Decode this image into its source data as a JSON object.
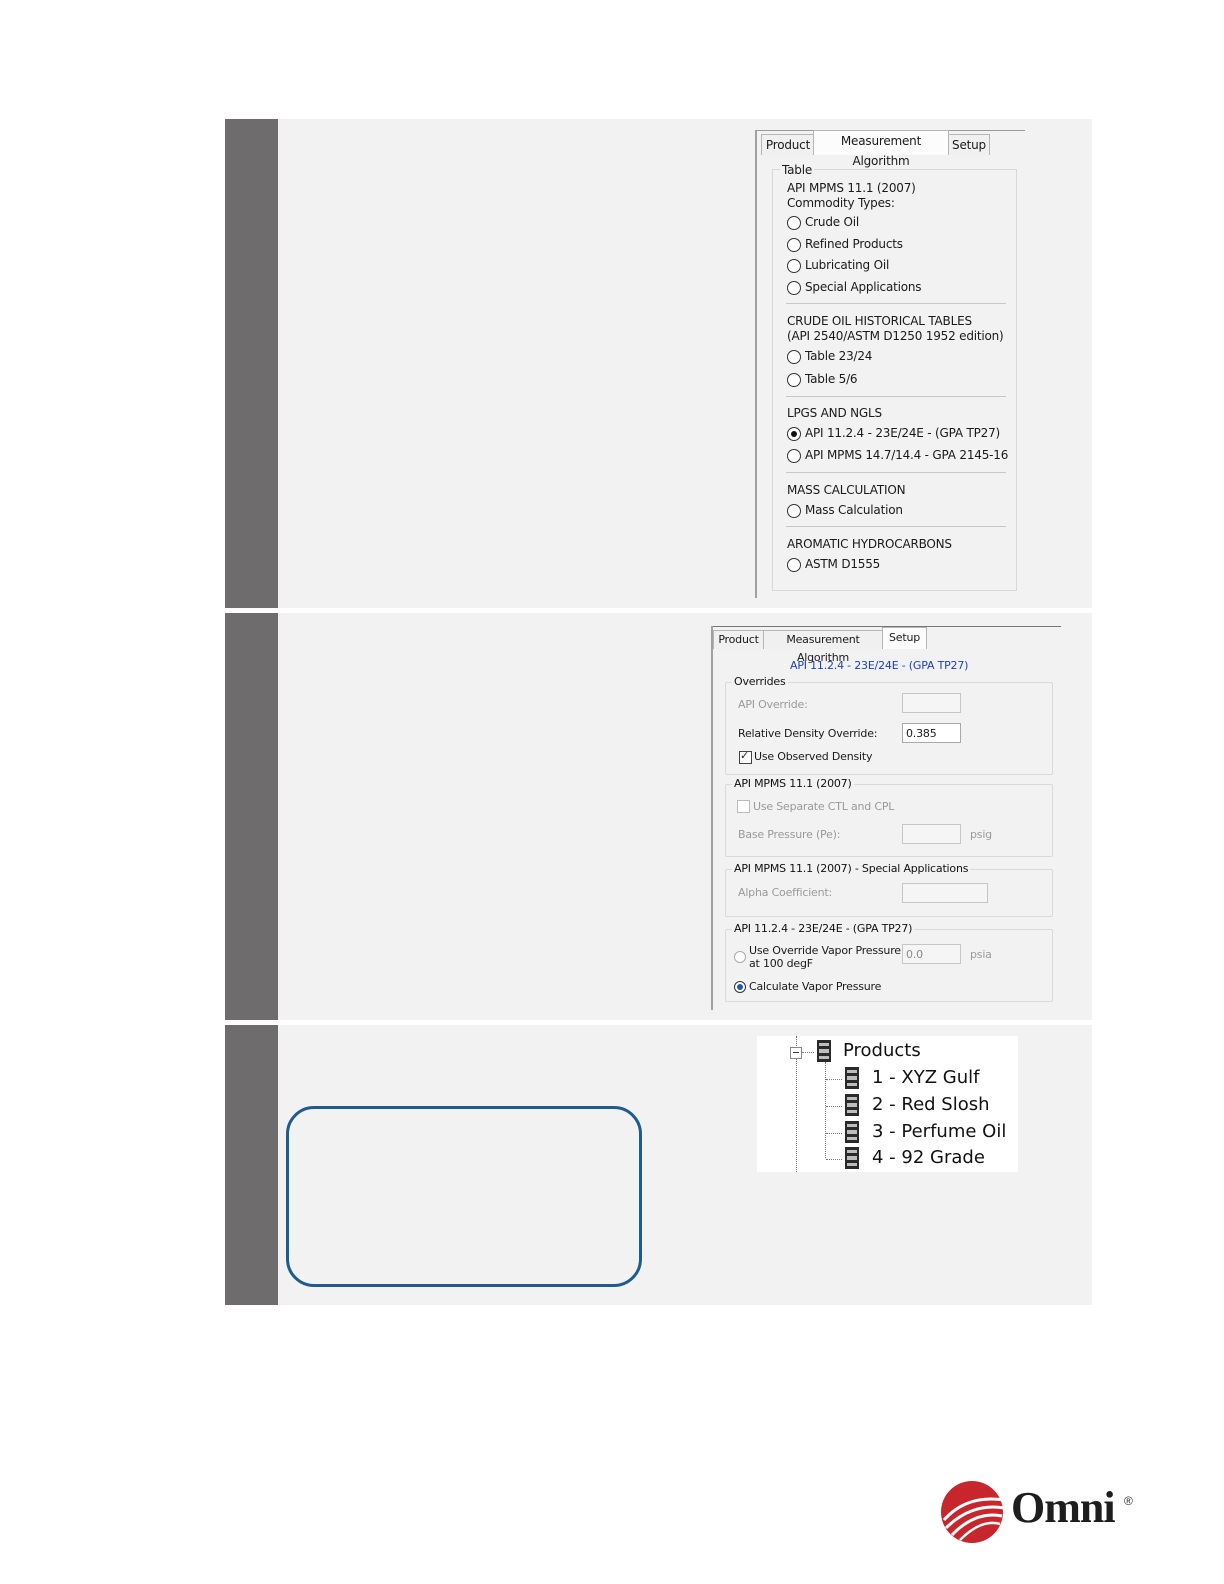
{
  "panel1": {
    "tabs": [
      "Product",
      "Measurement Algorithm",
      "Setup"
    ],
    "group_title": "Table",
    "api_heading": "API MPMS 11.1 (2007)",
    "commodity_heading": "Commodity Types:",
    "commodity_options": [
      "Crude Oil",
      "Refined Products",
      "Lubricating Oil",
      "Special Applications"
    ],
    "crude_heading": "CRUDE OIL HISTORICAL TABLES",
    "crude_subheading": "(API 2540/ASTM D1250 1952 edition)",
    "crude_options": [
      "Table 23/24",
      "Table 5/6"
    ],
    "lpg_heading": "LPGS AND NGLS",
    "lpg_options": [
      "API 11.2.4 - 23E/24E - (GPA TP27)",
      "API MPMS 14.7/14.4 - GPA 2145-16"
    ],
    "lpg_selected": "API 11.2.4 - 23E/24E - (GPA TP27)",
    "mass_heading": "MASS CALCULATION",
    "mass_options": [
      "Mass Calculation"
    ],
    "aromatic_heading": "AROMATIC HYDROCARBONS",
    "aromatic_options": [
      "ASTM D1555"
    ]
  },
  "panel2": {
    "tabs": [
      "Product",
      "Measurement Algorithm",
      "Setup"
    ],
    "selected_algorithm": "API 11.2.4 - 23E/24E - (GPA TP27)",
    "overrides_title": "Overrides",
    "api_override_label": "API Override:",
    "api_override_value": "",
    "rel_density_label": "Relative Density Override:",
    "rel_density_value": "0.385",
    "use_observed_label": "Use Observed Density",
    "use_observed_checked": true,
    "api2007_title": "API MPMS 11.1 (2007)",
    "separate_ctl_label": "Use Separate CTL and CPL",
    "base_pressure_label": "Base Pressure (Pe):",
    "base_pressure_value": "",
    "base_pressure_unit": "psig",
    "special_title": "API MPMS 11.1 (2007) - Special Applications",
    "alpha_label": "Alpha Coefficient:",
    "alpha_value": "",
    "tp27_title": "API 11.2.4 - 23E/24E - (GPA TP27)",
    "override_vapor_label_1": "Use Override Vapor Pressure",
    "override_vapor_label_2": "at 100 degF",
    "override_vapor_value": "0.0",
    "override_vapor_unit": "psia",
    "calc_vapor_label": "Calculate Vapor Pressure",
    "calc_vapor_selected": true
  },
  "panel3": {
    "root_label": "Products",
    "items": [
      "1 - XYZ Gulf",
      "2 - Red Slosh",
      "3 - Perfume Oil",
      "4 - 92 Grade"
    ]
  },
  "logo": {
    "text": "Omni",
    "mark": "®"
  },
  "colors": {
    "step_bar": "#6e6c6d",
    "step_bg": "#f2f2f2",
    "callout_border": "#1e5b8e",
    "link_blue": "#1f3fbf",
    "logo_red": "#c8262d"
  }
}
